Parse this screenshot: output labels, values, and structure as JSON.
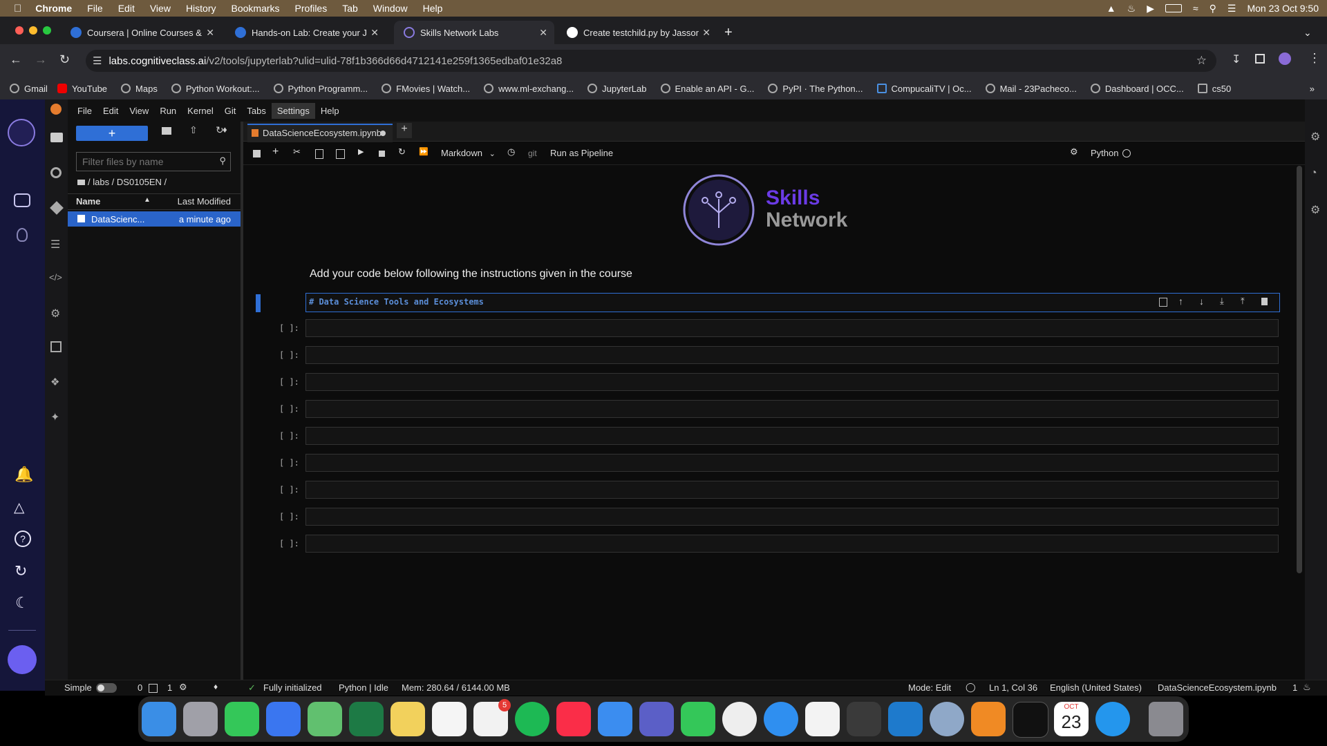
{
  "menubar": {
    "app": "Chrome",
    "items": [
      "File",
      "Edit",
      "View",
      "History",
      "Bookmarks",
      "Profiles",
      "Tab",
      "Window",
      "Help"
    ],
    "clock": "Mon 23 Oct  9:50"
  },
  "tabs": [
    {
      "title": "Coursera | Online Courses &",
      "active": false
    },
    {
      "title": "Hands-on Lab: Create your J",
      "active": false
    },
    {
      "title": "Skills Network Labs",
      "active": true
    },
    {
      "title": "Create testchild.py by Jassor",
      "active": false
    }
  ],
  "address": {
    "host": "labs.cognitiveclass.ai",
    "path": "/v2/tools/jupyterlab?ulid=ulid-78f1b366d66d4712141e259f1365edbaf01e32a8"
  },
  "bookmarks": [
    "Gmail",
    "YouTube",
    "Maps",
    "Python Workout:...",
    "Python Programm...",
    "FMovies | Watch...",
    "www.ml-exchang...",
    "JupyterLab",
    "Enable an API - G...",
    "PyPI · The Python...",
    "CompucaliTV | Oc...",
    "Mail - 23Pacheco...",
    "Dashboard | OCC...",
    "cs50"
  ],
  "jupyter_menu": [
    "File",
    "Edit",
    "View",
    "Run",
    "Kernel",
    "Git",
    "Tabs",
    "Settings",
    "Help"
  ],
  "filebrowser": {
    "new_label": "+",
    "filter_placeholder": "Filter files by name",
    "breadcrumb": "/ labs / DS0105EN /",
    "col_name": "Name",
    "col_modified": "Last Modified",
    "files": [
      {
        "name": "DataScienc...",
        "modified": "a minute ago"
      }
    ]
  },
  "notebook": {
    "tab_title": "DataScienceEcosystem.ipynb",
    "cell_type": "Markdown",
    "git_label": "git",
    "run_pipeline": "Run as Pipeline",
    "kernel": "Python",
    "logo_line1": "Skills",
    "logo_line2": "Network",
    "intro_text": "Add your code below following the instructions given in the course",
    "active_cell_text": "# Data Science Tools and Ecosystems",
    "empty_prompt": "[ ]:",
    "empty_cell_count": 9
  },
  "statusbar": {
    "mode_label": "Simple",
    "count_a": "0",
    "count_b": "1",
    "init": "Fully initialized",
    "kernel_status": "Python | Idle",
    "mem": "Mem: 280.64 / 6144.00 MB",
    "edit_mode": "Mode: Edit",
    "cursor": "Ln 1, Col 36",
    "language": "English (United States)",
    "filename": "DataScienceEcosystem.ipynb",
    "notif_count": "1"
  },
  "dock": {
    "reminders_badge": "5",
    "calendar_month": "OCT",
    "calendar_day": "23"
  },
  "colors": {
    "accent_blue": "#2f6fd6",
    "skills_purple": "#6b3be6",
    "file_selected": "#2a64c9"
  }
}
